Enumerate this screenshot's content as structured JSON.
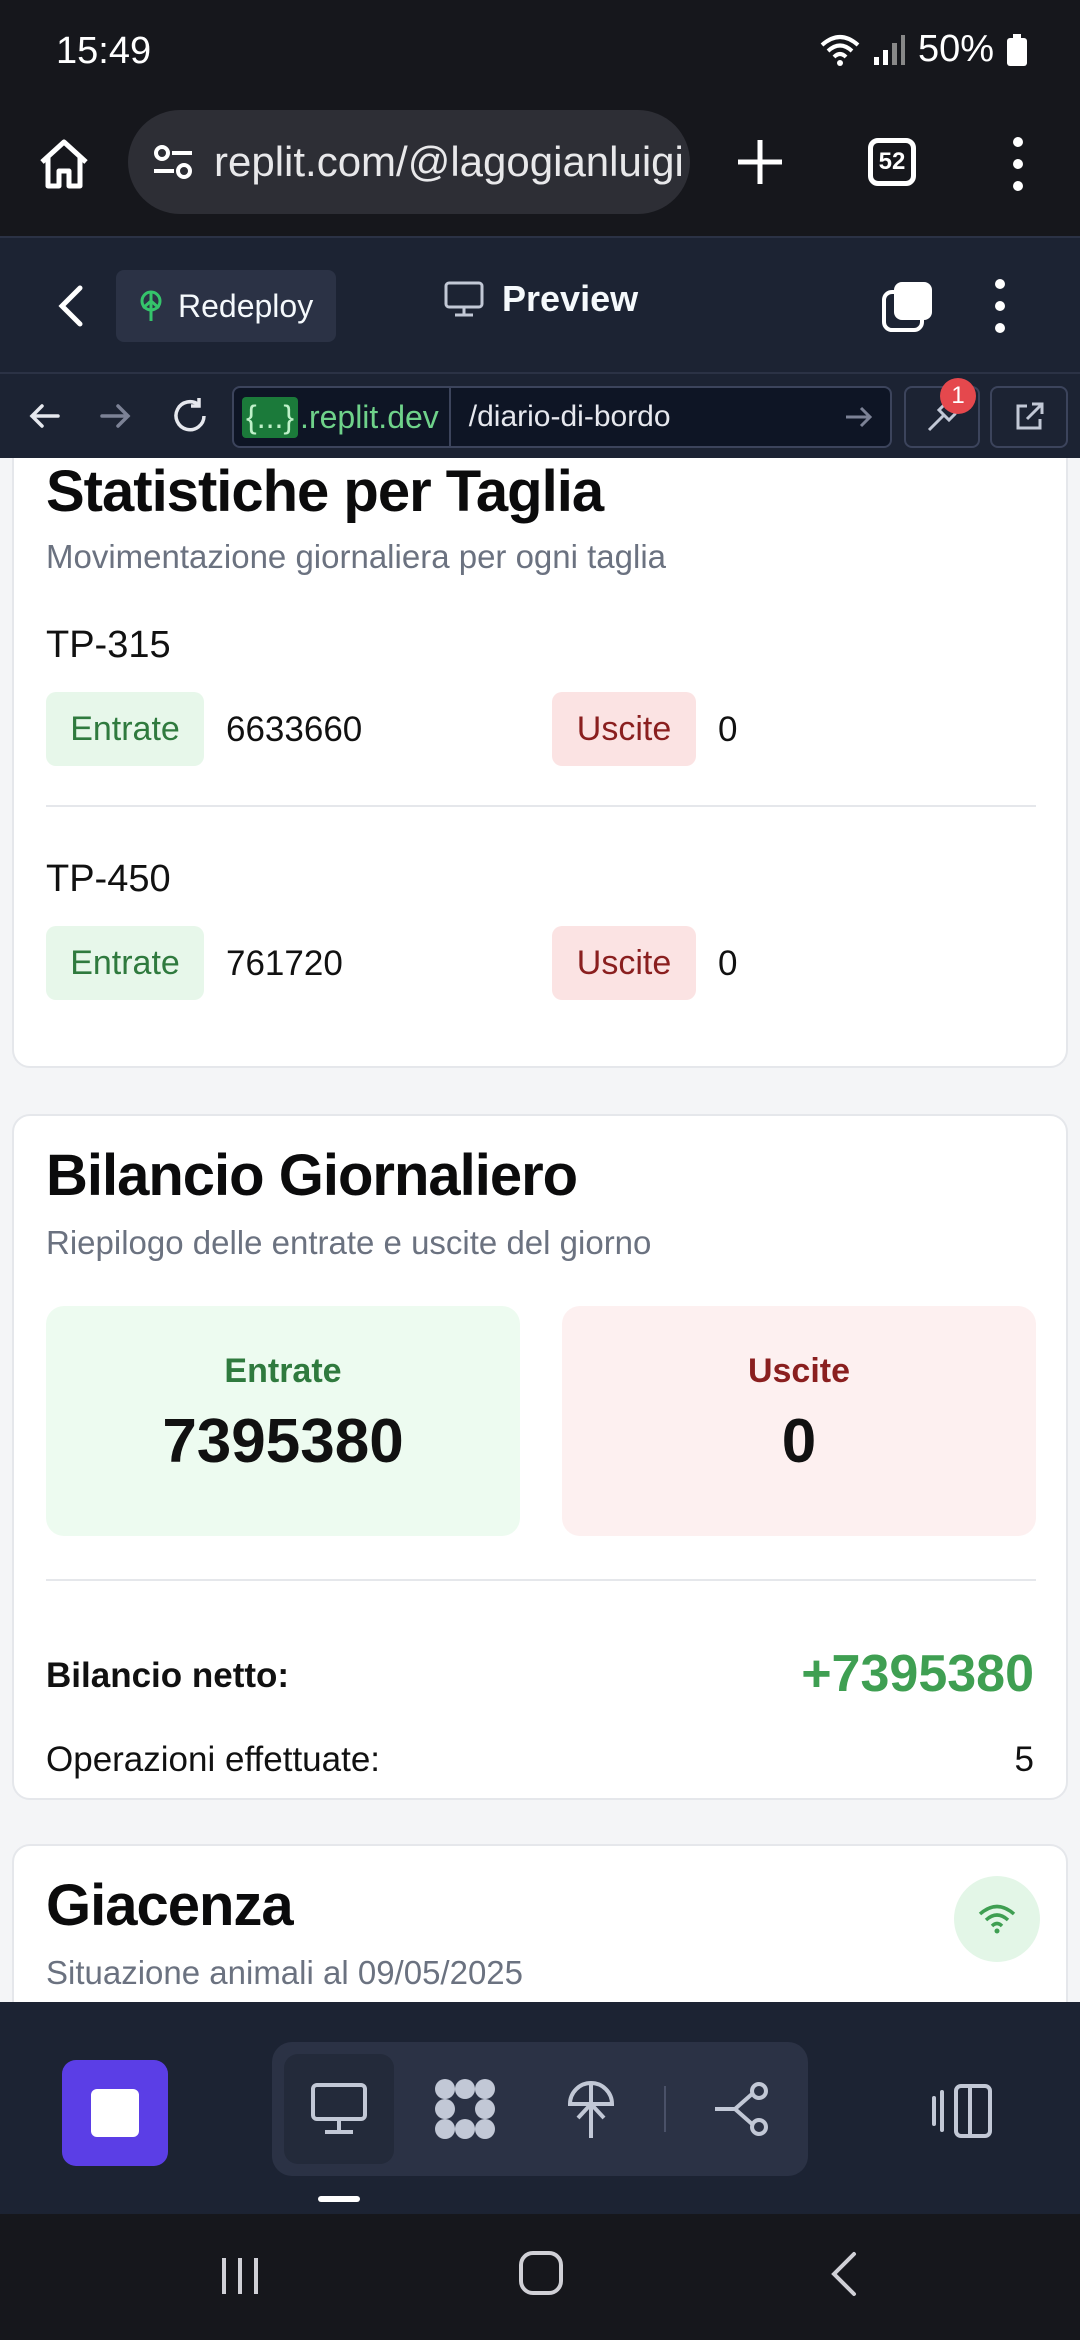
{
  "status_bar": {
    "time": "15:49",
    "battery": "50%"
  },
  "browser": {
    "url": "replit.com/@lagogianluigi",
    "tab_count": "52"
  },
  "replit_header": {
    "redeploy_label": "Redeploy",
    "preview_label": "Preview"
  },
  "preview_nav": {
    "domain_braces": "{...}",
    "domain_suffix": ".replit.dev",
    "path": "/diario-di-bordo",
    "tool_badge": "1"
  },
  "stats_card": {
    "title": "Statistiche per Taglia",
    "subtitle": "Movimentazione giornaliera per ogni taglia",
    "sizes": [
      {
        "name": "TP-315",
        "in_label": "Entrate",
        "in_value": "6633660",
        "out_label": "Uscite",
        "out_value": "0"
      },
      {
        "name": "TP-450",
        "in_label": "Entrate",
        "in_value": "761720",
        "out_label": "Uscite",
        "out_value": "0"
      }
    ]
  },
  "balance_card": {
    "title": "Bilancio Giornaliero",
    "subtitle": "Riepilogo delle entrate e uscite del giorno",
    "in_label": "Entrate",
    "in_value": "7395380",
    "out_label": "Uscite",
    "out_value": "0",
    "net_label": "Bilancio netto:",
    "net_value": "+7395380",
    "ops_label": "Operazioni effettuate:",
    "ops_value": "5"
  },
  "stock_card": {
    "title": "Giacenza",
    "subtitle": "Situazione animali al 09/05/2025"
  },
  "colors": {
    "in_green": "#2f7a3e",
    "out_red": "#8a1f1f",
    "net_green": "#3f9f52",
    "replit_bg": "#1c2333",
    "stop_purple": "#5b3ee6"
  }
}
